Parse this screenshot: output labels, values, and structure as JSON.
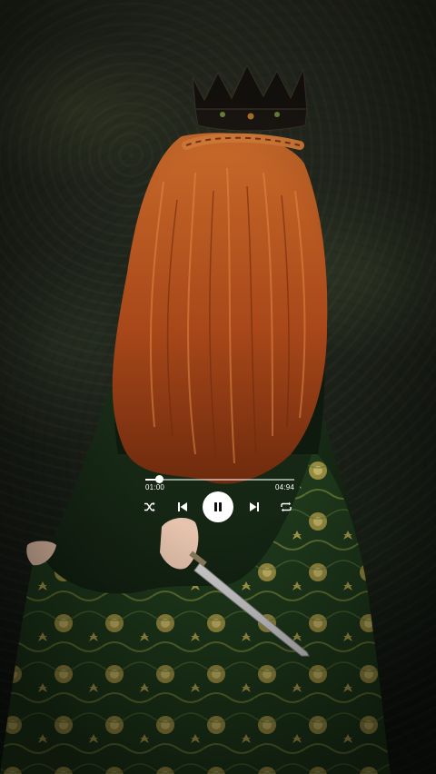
{
  "player": {
    "current_time": "01:00",
    "total_time": "04:94",
    "progress": 0.09,
    "state": "playing"
  },
  "icons": {
    "shuffle": "shuffle-icon",
    "previous": "skip-previous-icon",
    "pause": "pause-icon",
    "next": "skip-next-icon",
    "repeat": "repeat-icon"
  },
  "colors": {
    "hair": "#b5501c",
    "dress": "#1f3a1c",
    "gold": "#c9b45a",
    "control": "#ffffff"
  }
}
